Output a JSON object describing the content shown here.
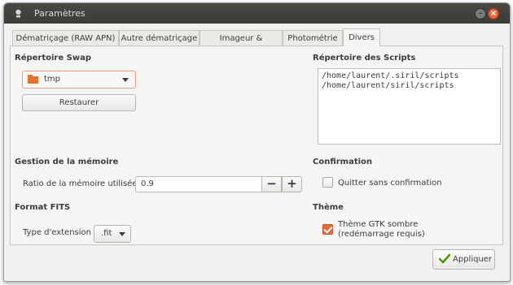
{
  "window": {
    "title": "Paramètres"
  },
  "tabs": [
    {
      "label": "Dématriçage (RAW APN)"
    },
    {
      "label": "Autre dématriçage"
    },
    {
      "label": "Imageur & Optiques"
    },
    {
      "label": "Photométrie"
    },
    {
      "label": "Divers",
      "active": true
    }
  ],
  "swap": {
    "title": "Répertoire Swap",
    "selected": "tmp",
    "restore_label": "Restaurer"
  },
  "scripts": {
    "title": "Répertoire  des Scripts",
    "paths": [
      "/home/laurent/.siril/scripts",
      "/home/laurent/siril/scripts"
    ]
  },
  "memory": {
    "title": "Gestion de la mémoire",
    "ratio_label": "Ratio de la mémoire utilisée :",
    "ratio_value": "0.9",
    "minus": "−",
    "plus": "+"
  },
  "confirmation": {
    "title": "Confirmation",
    "quit_label": "Quitter sans confirmation",
    "quit_checked": false
  },
  "fits": {
    "title": "Format FITS",
    "ext_label": "Type d'extension :",
    "ext_value": ".fit"
  },
  "theme": {
    "title": "Thème",
    "gtk_dark_line1": "Thème GTK sombre",
    "gtk_dark_line2": "(redémarrage requis)",
    "gtk_dark_checked": true
  },
  "actions": {
    "apply_label": "Appliquer"
  },
  "colors": {
    "accent": "#e36c3a",
    "titlebar": "#3c3b37"
  }
}
